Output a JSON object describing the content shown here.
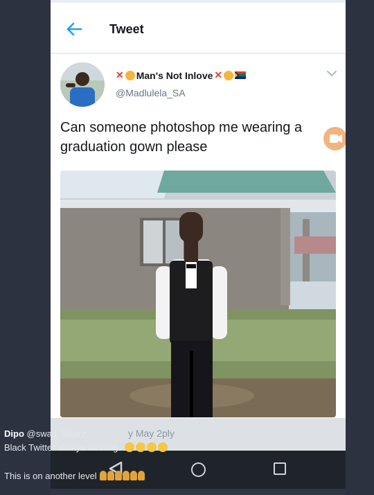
{
  "header": {
    "title": "Tweet"
  },
  "tweet": {
    "display_name": "Man's Not Inlove",
    "handle": "@Madlulela_SA",
    "text": "Can someone photoshop me wearing a graduation gown please"
  },
  "overlay": {
    "reply_ghost": "y May 2ply"
  },
  "comments": {
    "author": "Dipo",
    "author_handle": "@swag_lukarz",
    "line1": "Black Twitter always winning.",
    "line2": "This is on another level"
  },
  "colors": {
    "accent": "#1da1f2",
    "background": "#2f3542",
    "navbar": "#1f242b"
  },
  "icons": [
    "back-arrow-icon",
    "chevron-down-icon",
    "video-icon",
    "nav-back-icon",
    "nav-home-icon",
    "nav-recent-icon"
  ]
}
